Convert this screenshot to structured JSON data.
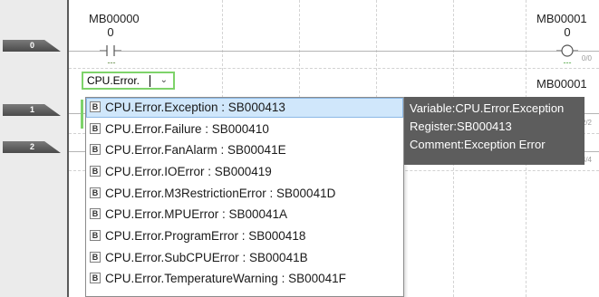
{
  "rungs": [
    {
      "number": "0",
      "step": "0/0"
    },
    {
      "number": "1",
      "step": "2/2"
    },
    {
      "number": "2",
      "step": "4/4"
    }
  ],
  "rung0": {
    "contact_address": "MB00000",
    "contact_value": "0",
    "contact_comment": "---",
    "coil_address": "MB00001",
    "coil_value": "0",
    "coil_comment": "---"
  },
  "rung1": {
    "coil_address": "MB00001"
  },
  "editor": {
    "value": "CPU.Error.",
    "dropdown_icon": "chevron-down-icon"
  },
  "autocomplete": {
    "item_icon": "bool-icon",
    "item_icon_glyph": "B",
    "selected_index": 0,
    "items": [
      "CPU.Error.Exception : SB000413",
      "CPU.Error.Failure : SB000410",
      "CPU.Error.FanAlarm : SB00041E",
      "CPU.Error.IOError : SB000419",
      "CPU.Error.M3RestrictionError : SB00041D",
      "CPU.Error.MPUError : SB00041A",
      "CPU.Error.ProgramError : SB000418",
      "CPU.Error.SubCPUError : SB00041B",
      "CPU.Error.TemperatureWarning : SB00041F"
    ]
  },
  "tooltip": {
    "variable": "Variable:CPU.Error.Exception",
    "register": "Register:SB000413",
    "comment": "Comment:Exception Error"
  },
  "colors": {
    "selection": "#d0e7fb",
    "tooltip_bg": "#5d5d5d",
    "editor_border": "#7ed36a",
    "coil_ok": "#3a9a2a"
  }
}
